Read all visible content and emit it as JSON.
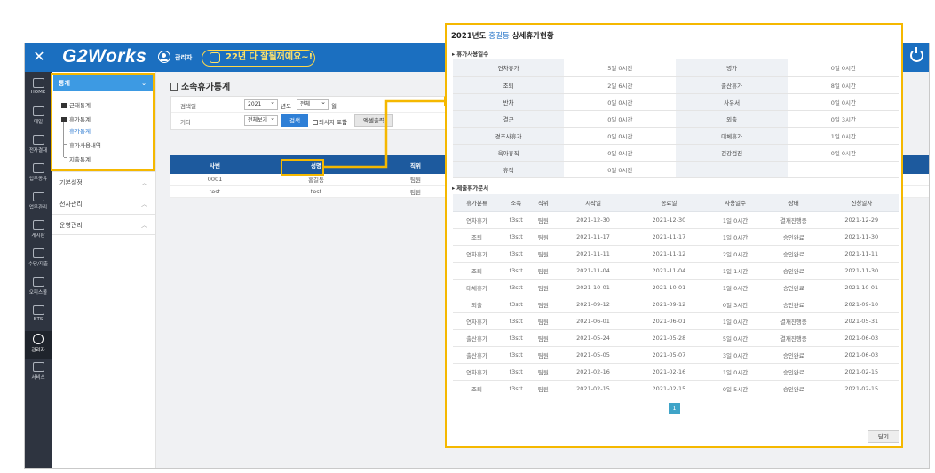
{
  "app": {
    "logo": "G2Works",
    "admin_label": "관리자",
    "banner_text": "22년 다 잘될꺼예요~!"
  },
  "iconnav": [
    {
      "label": "HOME",
      "icon": "home-icon"
    },
    {
      "label": "메일",
      "icon": "mail-icon"
    },
    {
      "label": "전자결재",
      "icon": "approval-icon"
    },
    {
      "label": "업무공유",
      "icon": "share-icon"
    },
    {
      "label": "업무관리",
      "icon": "task-icon"
    },
    {
      "label": "게시판",
      "icon": "board-icon"
    },
    {
      "label": "수당/지출",
      "icon": "expense-icon"
    },
    {
      "label": "오피스몰",
      "icon": "office-mall-icon"
    },
    {
      "label": "BTS",
      "icon": "bts-icon"
    },
    {
      "label": "관리자",
      "icon": "admin-icon"
    },
    {
      "label": "서비스",
      "icon": "service-icon"
    }
  ],
  "sidebar": {
    "header": "통계",
    "tree": [
      "근태통계",
      "휴가통계",
      "휴가통계",
      "휴가사용내역",
      "지출통계"
    ],
    "groups": [
      "기본설정",
      "전사관리",
      "운영관리"
    ]
  },
  "page": {
    "title": "소속휴가통계",
    "filter": {
      "search_label": "검색일",
      "year": "2021",
      "year_unit": "년도",
      "month": "전체",
      "month_unit": "월",
      "etc_label": "기타",
      "view": "전체보기",
      "search_btn": "검색",
      "retired_label": "퇴사자 포함",
      "excel_btn": "엑셀출력"
    },
    "table": {
      "headers": [
        "사번",
        "성명",
        "직위"
      ],
      "rows": [
        [
          "0001",
          "홍길동",
          "팀원"
        ],
        [
          "test",
          "test",
          "팀원"
        ]
      ]
    }
  },
  "popup": {
    "title_prefix": "2021년도",
    "name": "홍길동",
    "title_suffix": "상세휴가현황",
    "section1": "휴가사용일수",
    "summary": [
      [
        "연차휴가",
        "5일 0시간",
        "병가",
        "0일 0시간"
      ],
      [
        "조퇴",
        "2일 6시간",
        "출산휴가",
        "8일 0시간"
      ],
      [
        "반차",
        "0일 0시간",
        "사유서",
        "0일 0시간"
      ],
      [
        "결근",
        "0일 0시간",
        "외출",
        "0일 3시간"
      ],
      [
        "경조사휴가",
        "0일 0시간",
        "대체휴가",
        "1일 0시간"
      ],
      [
        "육아휴직",
        "0일 0시간",
        "건강검진",
        "0일 0시간"
      ],
      [
        "휴직",
        "0일 0시간",
        "",
        ""
      ]
    ],
    "section2": "제출휴가문서",
    "doc_headers": [
      "휴가분류",
      "소속",
      "직위",
      "시작일",
      "종료일",
      "사용일수",
      "상태",
      "신청일자"
    ],
    "docs": [
      [
        "연차휴가",
        "t3stt",
        "팀원",
        "2021-12-30",
        "2021-12-30",
        "1일 0시간",
        "결재진행중",
        "2021-12-29"
      ],
      [
        "조퇴",
        "t3stt",
        "팀원",
        "2021-11-17",
        "2021-11-17",
        "1일 0시간",
        "승인완료",
        "2021-11-30"
      ],
      [
        "연차휴가",
        "t3stt",
        "팀원",
        "2021-11-11",
        "2021-11-12",
        "2일 0시간",
        "승인완료",
        "2021-11-11"
      ],
      [
        "조퇴",
        "t3stt",
        "팀원",
        "2021-11-04",
        "2021-11-04",
        "1일 1시간",
        "승인완료",
        "2021-11-30"
      ],
      [
        "대체휴가",
        "t3stt",
        "팀원",
        "2021-10-01",
        "2021-10-01",
        "1일 0시간",
        "승인완료",
        "2021-10-01"
      ],
      [
        "외출",
        "t3stt",
        "팀원",
        "2021-09-12",
        "2021-09-12",
        "0일 3시간",
        "승인완료",
        "2021-09-10"
      ],
      [
        "연차휴가",
        "t3stt",
        "팀원",
        "2021-06-01",
        "2021-06-01",
        "1일 0시간",
        "결재진행중",
        "2021-05-31"
      ],
      [
        "출산휴가",
        "t3stt",
        "팀원",
        "2021-05-24",
        "2021-05-28",
        "5일 0시간",
        "결재진행중",
        "2021-06-03"
      ],
      [
        "출산휴가",
        "t3stt",
        "팀원",
        "2021-05-05",
        "2021-05-07",
        "3일 0시간",
        "승인완료",
        "2021-06-03"
      ],
      [
        "연차휴가",
        "t3stt",
        "팀원",
        "2021-02-16",
        "2021-02-16",
        "1일 0시간",
        "승인완료",
        "2021-02-15"
      ],
      [
        "조퇴",
        "t3stt",
        "팀원",
        "2021-02-15",
        "2021-02-15",
        "0일 5시간",
        "승인완료",
        "2021-02-15"
      ]
    ],
    "page_number": "1",
    "close_btn": "닫기"
  },
  "colors": {
    "topbar": "#1b6fc0",
    "highlight": "#f5b800",
    "table_header": "#1d5a9e",
    "sidebar_active": "#3d9ae3"
  }
}
